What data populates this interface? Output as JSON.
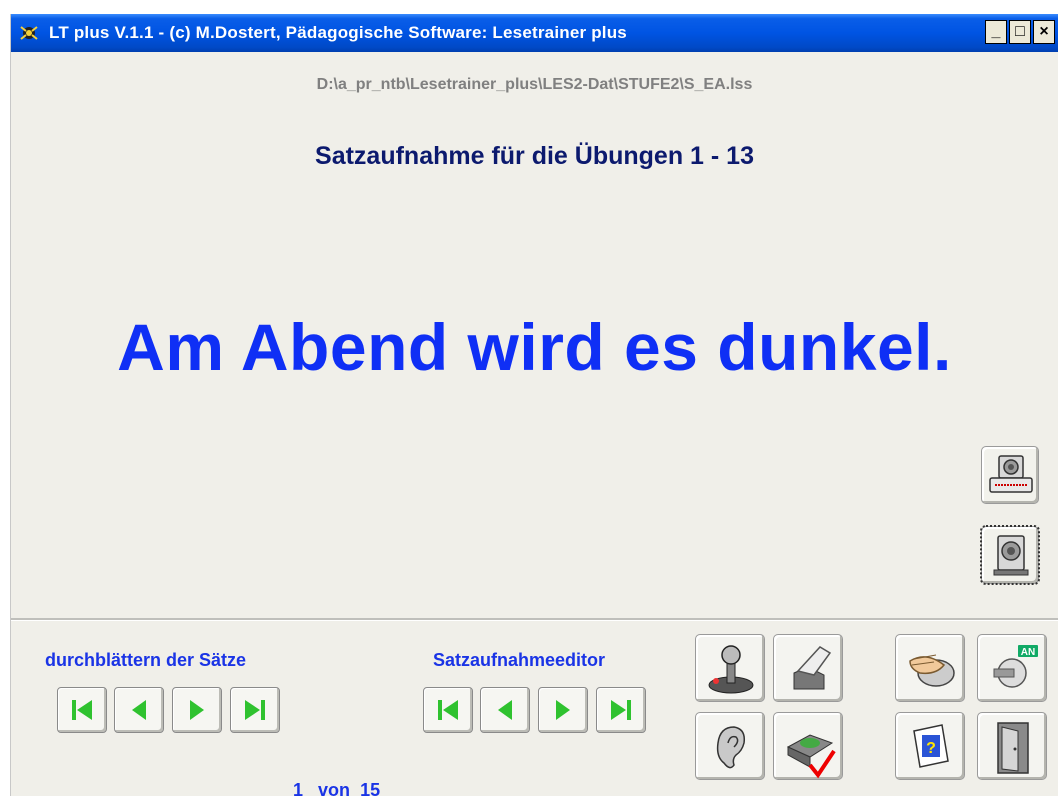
{
  "window": {
    "title": "LT plus   V.1.1 - (c) M.Dostert, Pädagogische Software: Lesetrainer plus",
    "minimize": "_",
    "maximize": "□",
    "close": "×"
  },
  "file_path": "D:\\a_pr_ntb\\Lesetrainer_plus\\LES2-Dat\\STUFE2\\S_EA.lss",
  "heading": "Satzaufnahme für die Übungen 1 - 13",
  "sentence": "Am Abend wird es dunkel.",
  "side_buttons": [
    {
      "icon": "speaker-printer-icon"
    },
    {
      "icon": "speaker-icon"
    }
  ],
  "browse": {
    "label": "durchblättern der Sätze",
    "buttons": [
      "first-icon",
      "previous-icon",
      "next-icon",
      "last-icon"
    ]
  },
  "editor": {
    "label": "Satzaufnahmeeditor",
    "buttons": [
      "first-icon",
      "previous-icon",
      "next-icon",
      "last-icon"
    ]
  },
  "counter": {
    "current": "1",
    "separator": "von",
    "total": "15"
  },
  "tools": [
    {
      "icon": "joystick-icon"
    },
    {
      "icon": "eraser-icon"
    },
    {
      "icon": "hand-mouse-icon"
    },
    {
      "icon": "on-switch-icon",
      "text": "AN"
    },
    {
      "icon": "ear-icon"
    },
    {
      "icon": "disk-save-check-icon"
    },
    {
      "icon": "help-icon",
      "text": "?"
    },
    {
      "icon": "exit-door-icon"
    }
  ],
  "colors": {
    "title_bar": "#0054e3",
    "heading": "#0c1a6e",
    "sentence": "#0f2ff5",
    "labels": "#1a34e6",
    "nav_arrow": "#2fc22f",
    "path": "#808080"
  }
}
